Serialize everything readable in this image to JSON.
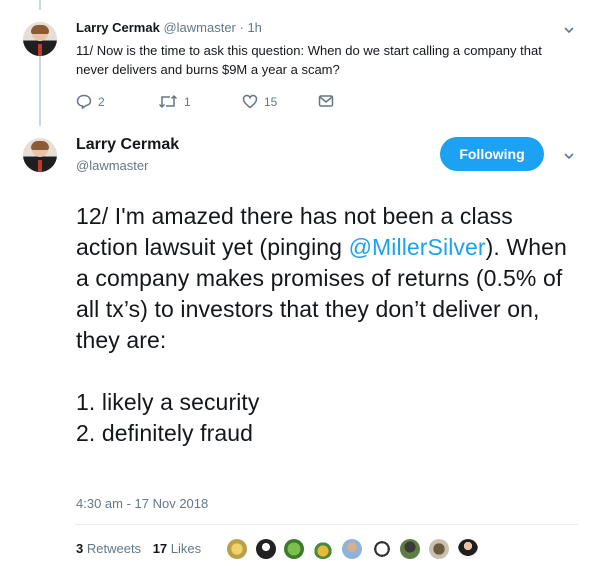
{
  "reply_tweet": {
    "author_name": "Larry Cermak",
    "author_handle": "@lawmaster",
    "time": "· 1h",
    "text": "11/ Now is the time to ask this question: When do we start calling a company that never delivers and burns $9M a year a scam?",
    "replies": "2",
    "retweets": "1",
    "likes": "15"
  },
  "main_tweet": {
    "author_name": "Larry Cermak",
    "author_handle": "@lawmaster",
    "follow_label": "Following",
    "text_before_mention": "12/ I'm amazed there has not been a class action lawsuit yet (pinging ",
    "mention": "@MillerSilver",
    "text_after_mention": "). When a company makes promises of returns (0.5% of all tx’s) to investors that they don’t deliver on, they are:",
    "list_items": [
      "1. likely a security",
      "2. definitely fraud"
    ],
    "timestamp": "4:30 am - 17 Nov 2018",
    "retweet_count": "3",
    "retweet_label": "Retweets",
    "like_count": "17",
    "like_label": "Likes"
  },
  "colors": {
    "accent": "#1da1f2",
    "muted": "#657786",
    "thread_line": "#ccd6dd"
  },
  "icons": [
    "reply-icon",
    "retweet-icon",
    "heart-icon",
    "message-icon",
    "chevron-down-icon"
  ]
}
